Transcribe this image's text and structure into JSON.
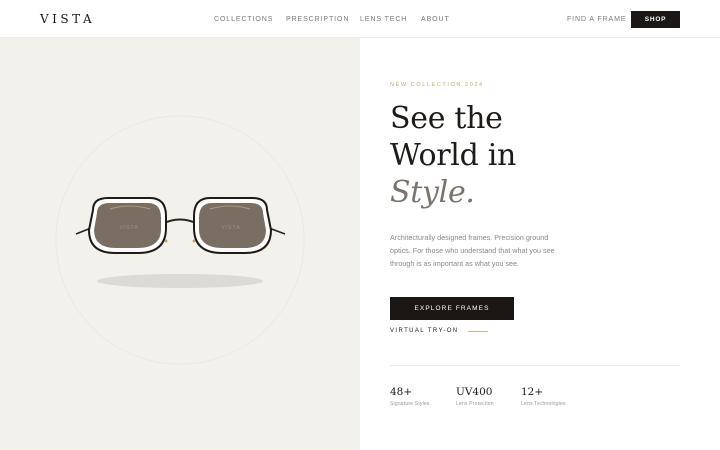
{
  "header": {
    "logo": "VISTA",
    "nav": [
      "COLLECTIONS",
      "PRESCRIPTION",
      "LENS TECH",
      "ABOUT"
    ],
    "find_frame": "FIND A FRAME",
    "shop": "SHOP"
  },
  "hero": {
    "lens_mark": "VISTA",
    "eyebrow": "NEW COLLECTION 2024",
    "headline": {
      "line1": "See the",
      "line2": "World in",
      "line3_italic": "Style."
    },
    "description": {
      "line1": "Architecturally designed frames. Precision ground",
      "line2": "optics. For those who understand that what you see",
      "line3": "through is as important as what you see."
    },
    "cta": "EXPLORE FRAMES",
    "secondary_link": "VIRTUAL TRY-ON",
    "stats": [
      {
        "value": "48+",
        "label": "Signature Styles"
      },
      {
        "value": "UV400",
        "label": "Lens Protection"
      },
      {
        "value": "12+",
        "label": "Lens Technologies"
      }
    ]
  },
  "colors": {
    "accent_gold": "#c6a56c",
    "dark": "#1b1714",
    "hero_left_bg": "#f3f1ec",
    "lens_tint": "#7a6e62"
  }
}
